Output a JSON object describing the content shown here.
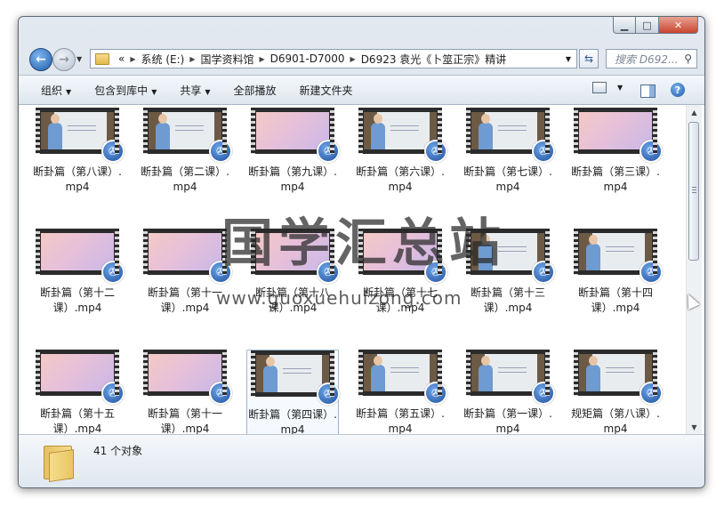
{
  "window": {
    "caption": {
      "minimize": "▁",
      "maximize": "□",
      "close": "✕"
    }
  },
  "nav": {
    "back_icon": "back-arrow-icon",
    "forward_icon": "forward-arrow-icon",
    "address": {
      "prefix": "«",
      "segments": [
        "系统 (E:)",
        "国学资料馆",
        "D6901-D7000",
        "D6923 袁光《卜筮正宗》精讲"
      ]
    },
    "search_placeholder": "搜索 D692..."
  },
  "toolbar": {
    "organize": "组织",
    "include_library": "包含到库中",
    "share": "共享",
    "play_all": "全部播放",
    "new_folder": "新建文件夹"
  },
  "files": [
    {
      "label": "断卦篇（第八课）.mp4",
      "thumb": "board"
    },
    {
      "label": "断卦篇（第二课）.mp4",
      "thumb": "board"
    },
    {
      "label": "断卦篇（第九课）.mp4",
      "thumb": "gradient"
    },
    {
      "label": "断卦篇（第六课）.mp4",
      "thumb": "board"
    },
    {
      "label": "断卦篇（第七课）.mp4",
      "thumb": "board"
    },
    {
      "label": "断卦篇（第三课）.mp4",
      "thumb": "gradient"
    },
    {
      "label": "断卦篇（第十二课）.mp4",
      "thumb": "gradient"
    },
    {
      "label": "断卦篇（第十一课）.mp4",
      "thumb": "gradient"
    },
    {
      "label": "断卦篇（第十八课）.mp4",
      "thumb": "gradient"
    },
    {
      "label": "断卦篇（第十七课）.mp4",
      "thumb": "gradient"
    },
    {
      "label": "断卦篇（第十三课）.mp4",
      "thumb": "board"
    },
    {
      "label": "断卦篇（第十四课）.mp4",
      "thumb": "board"
    },
    {
      "label": "断卦篇（第十五课）.mp4",
      "thumb": "gradient"
    },
    {
      "label": "断卦篇（第十一课）.mp4",
      "thumb": "gradient"
    },
    {
      "label": "断卦篇（第四课）.mp4",
      "thumb": "board",
      "selected": true
    },
    {
      "label": "断卦篇（第五课）.mp4",
      "thumb": "board"
    },
    {
      "label": "断卦篇（第一课）.mp4",
      "thumb": "board"
    },
    {
      "label": "规矩篇（第八课）.mp4",
      "thumb": "board"
    }
  ],
  "watermark": {
    "title": "国学汇总站",
    "url": "www.guoxuehuizong.com"
  },
  "details": {
    "count": "41 个对象"
  }
}
